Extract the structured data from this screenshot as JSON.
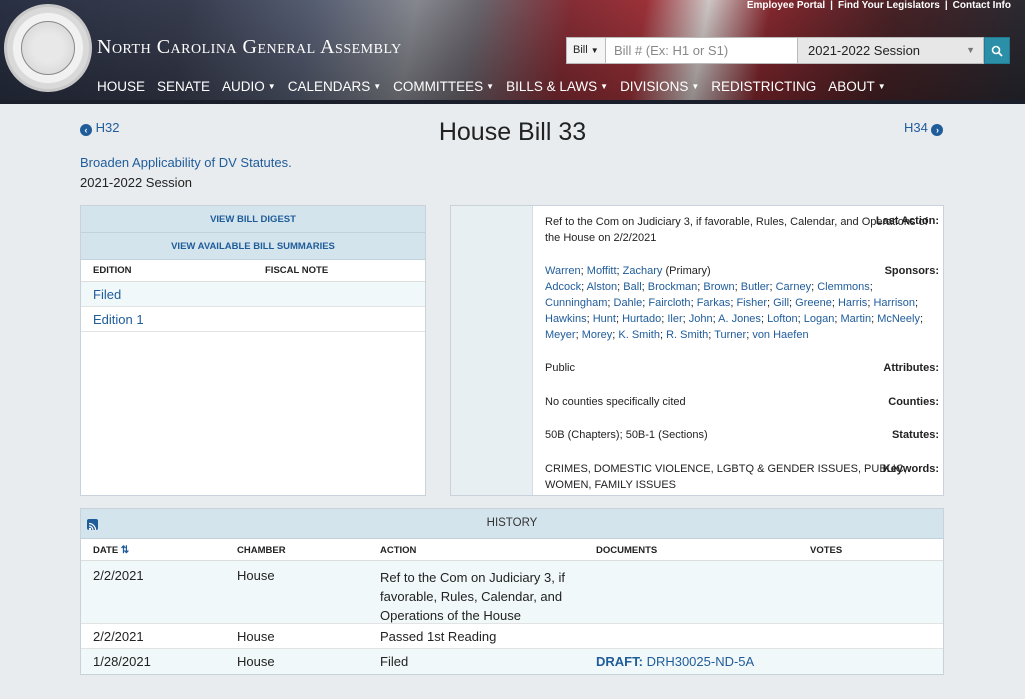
{
  "header": {
    "seal_text": "THE GREAT SEAL OF THE STATE OF NORTH CAROLINA",
    "site_title": "North Carolina General Assembly",
    "top_links": [
      "Employee Portal",
      "Find Your Legislators",
      "Contact Info"
    ],
    "search": {
      "type_label": "Bill",
      "placeholder": "Bill # (Ex: H1 or S1)",
      "session": "2021-2022 Session"
    },
    "nav": [
      {
        "label": "HOUSE",
        "caret": false
      },
      {
        "label": "SENATE",
        "caret": false
      },
      {
        "label": "AUDIO",
        "caret": true
      },
      {
        "label": "CALENDARS",
        "caret": true
      },
      {
        "label": "COMMITTEES",
        "caret": true
      },
      {
        "label": "BILLS & LAWS",
        "caret": true
      },
      {
        "label": "DIVISIONS",
        "caret": true
      },
      {
        "label": "REDISTRICTING",
        "caret": false
      },
      {
        "label": "ABOUT",
        "caret": true
      }
    ]
  },
  "bill": {
    "prev": "H32",
    "next": "H34",
    "title": "House Bill 33",
    "short_title": "Broaden Applicability of DV Statutes.",
    "session": "2021-2022 Session"
  },
  "editions": {
    "digest_button": "VIEW BILL DIGEST",
    "summaries_button": "VIEW AVAILABLE BILL SUMMARIES",
    "col_edition": "EDITION",
    "col_fiscal": "FISCAL NOTE",
    "rows": [
      "Filed",
      "Edition 1"
    ]
  },
  "info": {
    "last_action_label": "Last Action:",
    "last_action": "Ref to the Com on Judiciary 3, if favorable, Rules, Calendar, and Operations of the House on 2/2/2021",
    "sponsors_label": "Sponsors:",
    "primary_sponsors": [
      "Warren",
      "Moffitt",
      "Zachary"
    ],
    "primary_note": "(Primary)",
    "sponsors": [
      "Adcock",
      "Alston",
      "Ball",
      "Brockman",
      "Brown",
      "Butler",
      "Carney",
      "Clemmons",
      "Cunningham",
      "Dahle",
      "Faircloth",
      "Farkas",
      "Fisher",
      "Gill",
      "Greene",
      "Harris",
      "Harrison",
      "Hawkins",
      "Hunt",
      "Hurtado",
      "Iler",
      "John",
      "A. Jones",
      "Lofton",
      "Logan",
      "Martin",
      "McNeely",
      "Meyer",
      "Morey",
      "K. Smith",
      "R. Smith",
      "Turner",
      "von Haefen"
    ],
    "attributes_label": "Attributes:",
    "attributes": "Public",
    "counties_label": "Counties:",
    "counties": "No counties specifically cited",
    "statutes_label": "Statutes:",
    "statutes": "50B (Chapters); 50B-1 (Sections)",
    "keywords_label": "Keywords:",
    "keywords": "CRIMES, DOMESTIC VIOLENCE, LGBTQ & GENDER ISSUES, PUBLIC, WOMEN, FAMILY ISSUES"
  },
  "history": {
    "title": "HISTORY",
    "columns": {
      "date": "DATE",
      "chamber": "CHAMBER",
      "action": "ACTION",
      "documents": "DOCUMENTS",
      "votes": "VOTES"
    },
    "rows": [
      {
        "date": "2/2/2021",
        "chamber": "House",
        "action": "Ref to the Com on Judiciary 3, if favorable, Rules, Calendar, and Operations of the House",
        "doc_prefix": "",
        "doc_link": "",
        "votes": ""
      },
      {
        "date": "2/2/2021",
        "chamber": "House",
        "action": "Passed 1st Reading",
        "doc_prefix": "",
        "doc_link": "",
        "votes": ""
      },
      {
        "date": "1/28/2021",
        "chamber": "House",
        "action": "Filed",
        "doc_prefix": "DRAFT:",
        "doc_link": "DRH30025-ND-5A",
        "votes": ""
      }
    ]
  }
}
